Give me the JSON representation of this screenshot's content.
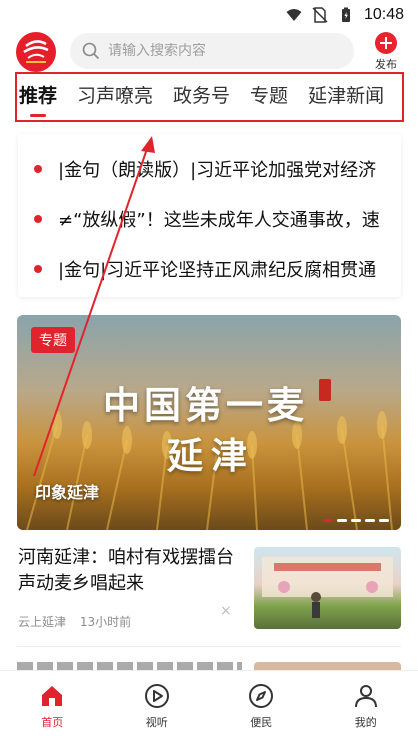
{
  "status_bar": {
    "time": "10:48",
    "icons": [
      "wifi-icon",
      "no-sim-icon",
      "battery-icon"
    ]
  },
  "header": {
    "logo": "app-logo",
    "search_placeholder": "请输入搜索内容",
    "publish_label": "发布"
  },
  "tabs": [
    {
      "label": "推荐",
      "active": true
    },
    {
      "label": "习声嘹亮",
      "active": false
    },
    {
      "label": "政务号",
      "active": false
    },
    {
      "label": "专题",
      "active": false
    },
    {
      "label": "延津新闻",
      "active": false
    }
  ],
  "headlines": [
    {
      "text": "|金句（朗读版）|习近平论加强党对经济"
    },
    {
      "text": "≠“放纵假”！这些未成年人交通事故，速"
    },
    {
      "text": "|金句|习近平论坚持正风肃纪反腐相贯通"
    }
  ],
  "banner": {
    "tag": "专题",
    "title_line1": "中国第一麦",
    "title_line2": "延津",
    "caption": "印象延津",
    "slide_count": 5,
    "active_slide": 1
  },
  "article": {
    "title": "河南延津：咱村有戏摆擂台声动麦乡唱起来",
    "source": "云上延津",
    "time": "13小时前",
    "dismiss": "×"
  },
  "bottom_nav": [
    {
      "label": "首页",
      "icon": "home-icon",
      "active": true
    },
    {
      "label": "视听",
      "icon": "play-icon",
      "active": false
    },
    {
      "label": "便民",
      "icon": "compass-icon",
      "active": false
    },
    {
      "label": "我的",
      "icon": "user-icon",
      "active": false
    }
  ],
  "colors": {
    "accent": "#e0242d",
    "annotation": "#e0242d"
  }
}
